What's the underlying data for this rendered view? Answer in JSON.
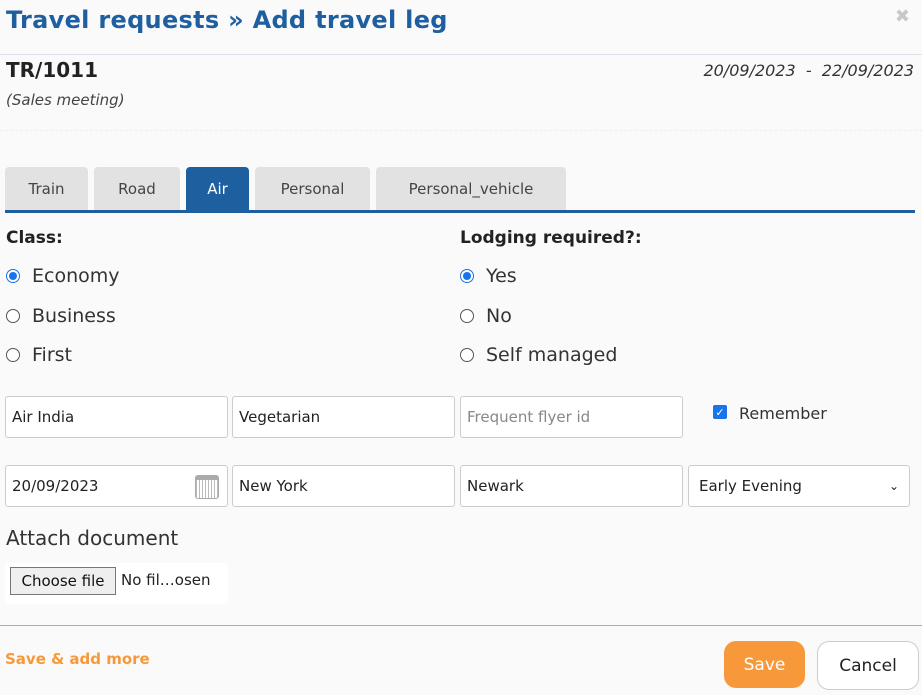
{
  "header": {
    "title": "Travel requests » Add travel leg",
    "close": "✖"
  },
  "request": {
    "ref": "TR/1011",
    "purpose": "(Sales meeting)",
    "dates": "20/09/2023  -  22/09/2023"
  },
  "tabs": [
    {
      "label": "Train"
    },
    {
      "label": "Road"
    },
    {
      "label": "Air",
      "active": true
    },
    {
      "label": "Personal"
    },
    {
      "label": "Personal_vehicle"
    }
  ],
  "class": {
    "label": "Class:",
    "options": [
      "Economy",
      "Business",
      "First"
    ],
    "selected": "Economy"
  },
  "lodging": {
    "label": "Lodging required?:",
    "options": [
      "Yes",
      "No",
      "Self managed"
    ],
    "selected": "Yes"
  },
  "fields": {
    "airline": "Air India",
    "meal": "Vegetarian",
    "ffid_placeholder": "Frequent flyer id",
    "remember": "Remember",
    "remember_checked": true,
    "date": "20/09/2023",
    "from": "New York",
    "to": "Newark",
    "time": "Early Evening"
  },
  "attach": {
    "label": "Attach document",
    "button": "Choose file",
    "status": "No fil…osen"
  },
  "footer": {
    "save_add": "Save & add more",
    "save": "Save",
    "cancel": "Cancel"
  },
  "colors": {
    "primary": "#1e5fa0",
    "accent": "#f7993a"
  }
}
